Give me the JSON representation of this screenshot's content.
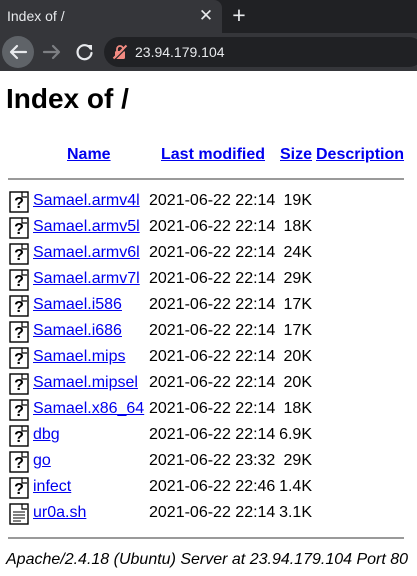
{
  "browser": {
    "tab_title": "Index of /",
    "tab_close": "✕",
    "new_tab": "+",
    "url": "23.94.179.104"
  },
  "page": {
    "title": "Index of /",
    "columns": {
      "name": "Name",
      "last_modified": "Last modified",
      "size": "Size",
      "description": "Description"
    },
    "rows": [
      {
        "name": "Samael.armv4l",
        "date": "2021-06-22 22:14",
        "size": "19K",
        "icon": "unknown-file-icon"
      },
      {
        "name": "Samael.armv5l",
        "date": "2021-06-22 22:14",
        "size": "18K",
        "icon": "unknown-file-icon"
      },
      {
        "name": "Samael.armv6l",
        "date": "2021-06-22 22:14",
        "size": "24K",
        "icon": "unknown-file-icon"
      },
      {
        "name": "Samael.armv7l",
        "date": "2021-06-22 22:14",
        "size": "29K",
        "icon": "unknown-file-icon"
      },
      {
        "name": "Samael.i586",
        "date": "2021-06-22 22:14",
        "size": "17K",
        "icon": "unknown-file-icon"
      },
      {
        "name": "Samael.i686",
        "date": "2021-06-22 22:14",
        "size": "17K",
        "icon": "unknown-file-icon"
      },
      {
        "name": "Samael.mips",
        "date": "2021-06-22 22:14",
        "size": "20K",
        "icon": "unknown-file-icon"
      },
      {
        "name": "Samael.mipsel",
        "date": "2021-06-22 22:14",
        "size": "20K",
        "icon": "unknown-file-icon"
      },
      {
        "name": "Samael.x86_64",
        "date": "2021-06-22 22:14",
        "size": "18K",
        "icon": "unknown-file-icon"
      },
      {
        "name": "dbg",
        "date": "2021-06-22 22:14",
        "size": "6.9K",
        "icon": "unknown-file-icon"
      },
      {
        "name": "go",
        "date": "2021-06-22 23:32",
        "size": "29K",
        "icon": "unknown-file-icon"
      },
      {
        "name": "infect",
        "date": "2021-06-22 22:46",
        "size": "1.4K",
        "icon": "unknown-file-icon"
      },
      {
        "name": "ur0a.sh",
        "date": "2021-06-22 22:14",
        "size": "3.1K",
        "icon": "text-file-icon"
      }
    ],
    "footer": "Apache/2.4.18 (Ubuntu) Server at 23.94.179.104 Port 80"
  },
  "colors": {
    "link": "#0000ee",
    "chrome_dark": "#202124",
    "chrome_toolbar": "#35363a",
    "insecure_icon": "#f28b82"
  }
}
